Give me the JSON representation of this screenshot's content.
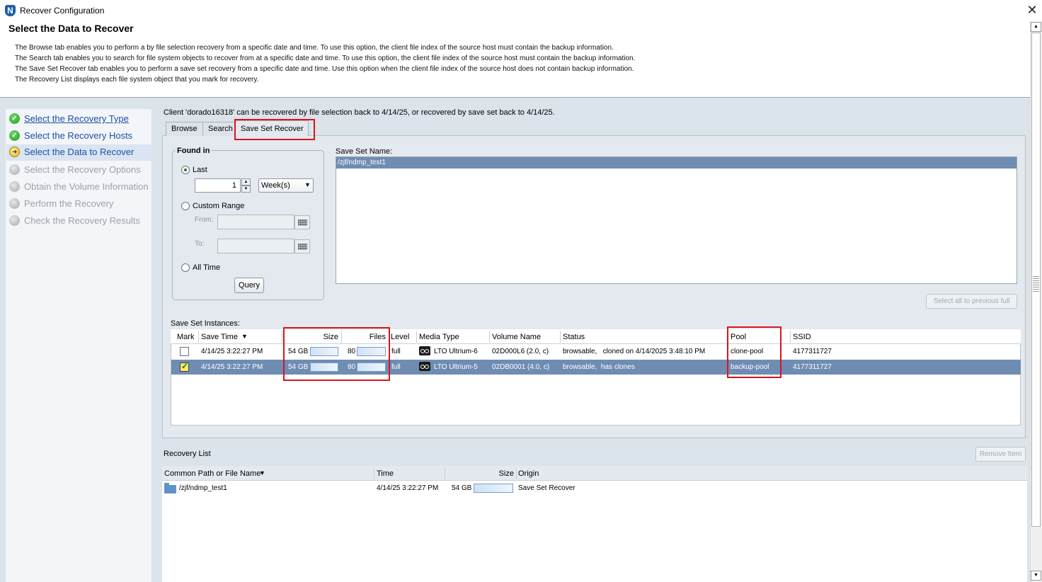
{
  "window": {
    "title": "Recover Configuration",
    "close_glyph": "✕"
  },
  "page": {
    "title": "Select the Data to Recover",
    "description": [
      "The Browse tab enables you to perform a by file selection recovery from a specific date and time. To use this option, the client file index of the source host must contain the backup information.",
      "The Search tab enables you to search for file system objects to recover from at a specific date and time. To use this option, the client file index of the source host must contain the backup information.",
      "The Save Set Recover tab enables you to perform a save set recovery from a specific date and time.  Use this option when the client file index of the source host does not contain backup information.",
      "The Recovery List displays each file system object that you mark for recovery."
    ]
  },
  "steps": [
    {
      "label": "Select the Recovery Type",
      "state": "done"
    },
    {
      "label": "Select the Recovery Hosts",
      "state": "done"
    },
    {
      "label": "Select the Data to Recover",
      "state": "current"
    },
    {
      "label": "Select the Recovery Options",
      "state": "todo"
    },
    {
      "label": "Obtain the Volume Information",
      "state": "todo"
    },
    {
      "label": "Perform the Recovery",
      "state": "todo"
    },
    {
      "label": "Check the Recovery Results",
      "state": "todo"
    }
  ],
  "client_message": "Client 'dorado16318' can be recovered by file selection back to 4/14/25, or recovered by save set back to 4/14/25.",
  "tabs": [
    {
      "label": "Browse",
      "active": false
    },
    {
      "label": "Search",
      "active": false
    },
    {
      "label": "Save Set Recover",
      "active": true
    }
  ],
  "found_in": {
    "title": "Found in",
    "last_label": "Last",
    "last_value": "1",
    "unit_value": "Week(s)",
    "custom_label": "Custom Range",
    "from_label": "From:",
    "to_label": "To:",
    "alltime_label": "All Time",
    "query_label": "Query"
  },
  "save_set_name": {
    "label": "Save Set Name:",
    "items": [
      "/zjf/ndmp_test1"
    ]
  },
  "select_all_label": "Select all to previous full",
  "instances": {
    "label": "Save Set Instances:",
    "columns": [
      "Mark",
      "Save Time",
      "Size",
      "Files",
      "Level",
      "Media Type",
      "Volume Name",
      "Status",
      "Pool",
      "SSID"
    ],
    "sort_indicator": "▼",
    "rows": [
      {
        "marked": false,
        "save_time": "4/14/25 3:22:27 PM",
        "size": "54 GB",
        "files": "80",
        "level": "full",
        "media_type": "LTO Ultrium-6",
        "volume": "02D000L6 (2.0, c)",
        "status": "browsable,   cloned on 4/14/2025 3:48:10 PM",
        "pool": "clone-pool",
        "ssid": "4177311727"
      },
      {
        "marked": true,
        "save_time": "4/14/25 3:22:27 PM",
        "size": "54 GB",
        "files": "80",
        "level": "full",
        "media_type": "LTO Ultrium-5",
        "volume": "02DB0001 (4.0, c)",
        "status": "browsable,  has clones",
        "pool": "backup-pool",
        "ssid": "4177311727"
      }
    ]
  },
  "recovery_list": {
    "title": "Recovery List",
    "remove_label": "Remove Item",
    "columns": [
      "Common Path or File Name",
      "Time",
      "Size",
      "Origin"
    ],
    "sort_indicator": "▼",
    "rows": [
      {
        "path": "/zjf/ndmp_test1",
        "time": "4/14/25 3:22:27 PM",
        "size": "54 GB",
        "origin": "Save Set Recover"
      }
    ]
  },
  "colors": {
    "selection": "#6f8db3",
    "highlight_box": "#d9141c",
    "link": "#1b4fa8"
  }
}
